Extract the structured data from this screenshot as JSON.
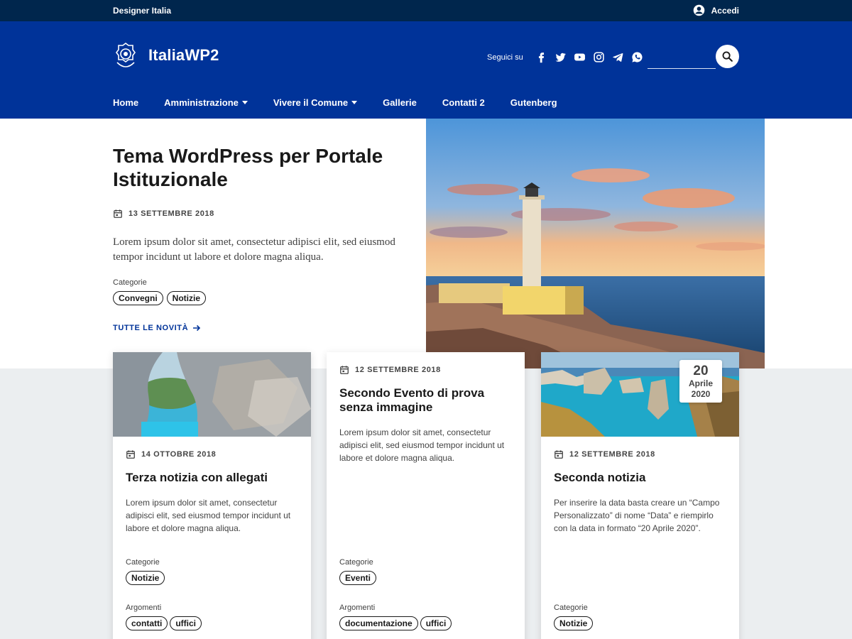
{
  "topbar": {
    "brand": "Designer Italia",
    "login_label": "Accedi"
  },
  "header": {
    "site_title": "ItaliaWP2",
    "social_label": "Seguici su",
    "social_icons": [
      "facebook-icon",
      "twitter-icon",
      "youtube-icon",
      "instagram-icon",
      "telegram-icon",
      "whatsapp-icon"
    ],
    "search_placeholder": ""
  },
  "nav": {
    "items": [
      {
        "label": "Home"
      },
      {
        "label": "Amministrazione"
      },
      {
        "label": "Vivere il Comune"
      },
      {
        "label": "Gallerie"
      },
      {
        "label": "Contatti 2"
      },
      {
        "label": "Gutenberg"
      }
    ]
  },
  "hero": {
    "title": "Tema WordPress per Portale Istituzionale",
    "date": "13 SETTEMBRE 2018",
    "description": "Lorem ipsum dolor sit amet, consectetur adipisci elit, sed eiusmod tempor incidunt ut labore et dolore magna aliqua.",
    "categories_label": "Categorie",
    "categories": [
      "Convegni",
      "Notizie"
    ],
    "all_news_label": "TUTTE LE NOVITÀ"
  },
  "cards": [
    {
      "date": "14 OTTOBRE 2018",
      "title": "Terza notizia con allegati",
      "description": "Lorem ipsum dolor sit amet, consectetur adipisci elit, sed eiusmod tempor incidunt ut labore et dolore magna aliqua.",
      "categories_label": "Categorie",
      "categories": [
        "Notizie"
      ],
      "topics_label": "Argomenti",
      "topics": [
        "contatti",
        "uffici"
      ]
    },
    {
      "date": "12 SETTEMBRE 2018",
      "title": "Secondo Evento di prova senza immagine",
      "description": "Lorem ipsum dolor sit amet, consectetur adipisci elit, sed eiusmod tempor incidunt ut labore et dolore magna aliqua.",
      "categories_label": "Categorie",
      "categories": [
        "Eventi"
      ],
      "topics_label": "Argomenti",
      "topics": [
        "documentazione",
        "uffici"
      ]
    },
    {
      "date": "12 SETTEMBRE 2018",
      "title": "Seconda notizia",
      "description": "Per inserire la data basta creare un “Campo Personalizzato” di nome “Data” e riempirlo con la data in formato “20 Aprile 2020”.",
      "badge": {
        "day": "20",
        "month": "Aprile",
        "year": "2020"
      },
      "categories_label": "Categorie",
      "categories": [
        "Notizie"
      ]
    }
  ],
  "colors": {
    "primary": "#003399",
    "topbar": "#00264d",
    "background": "#ebeef0"
  }
}
